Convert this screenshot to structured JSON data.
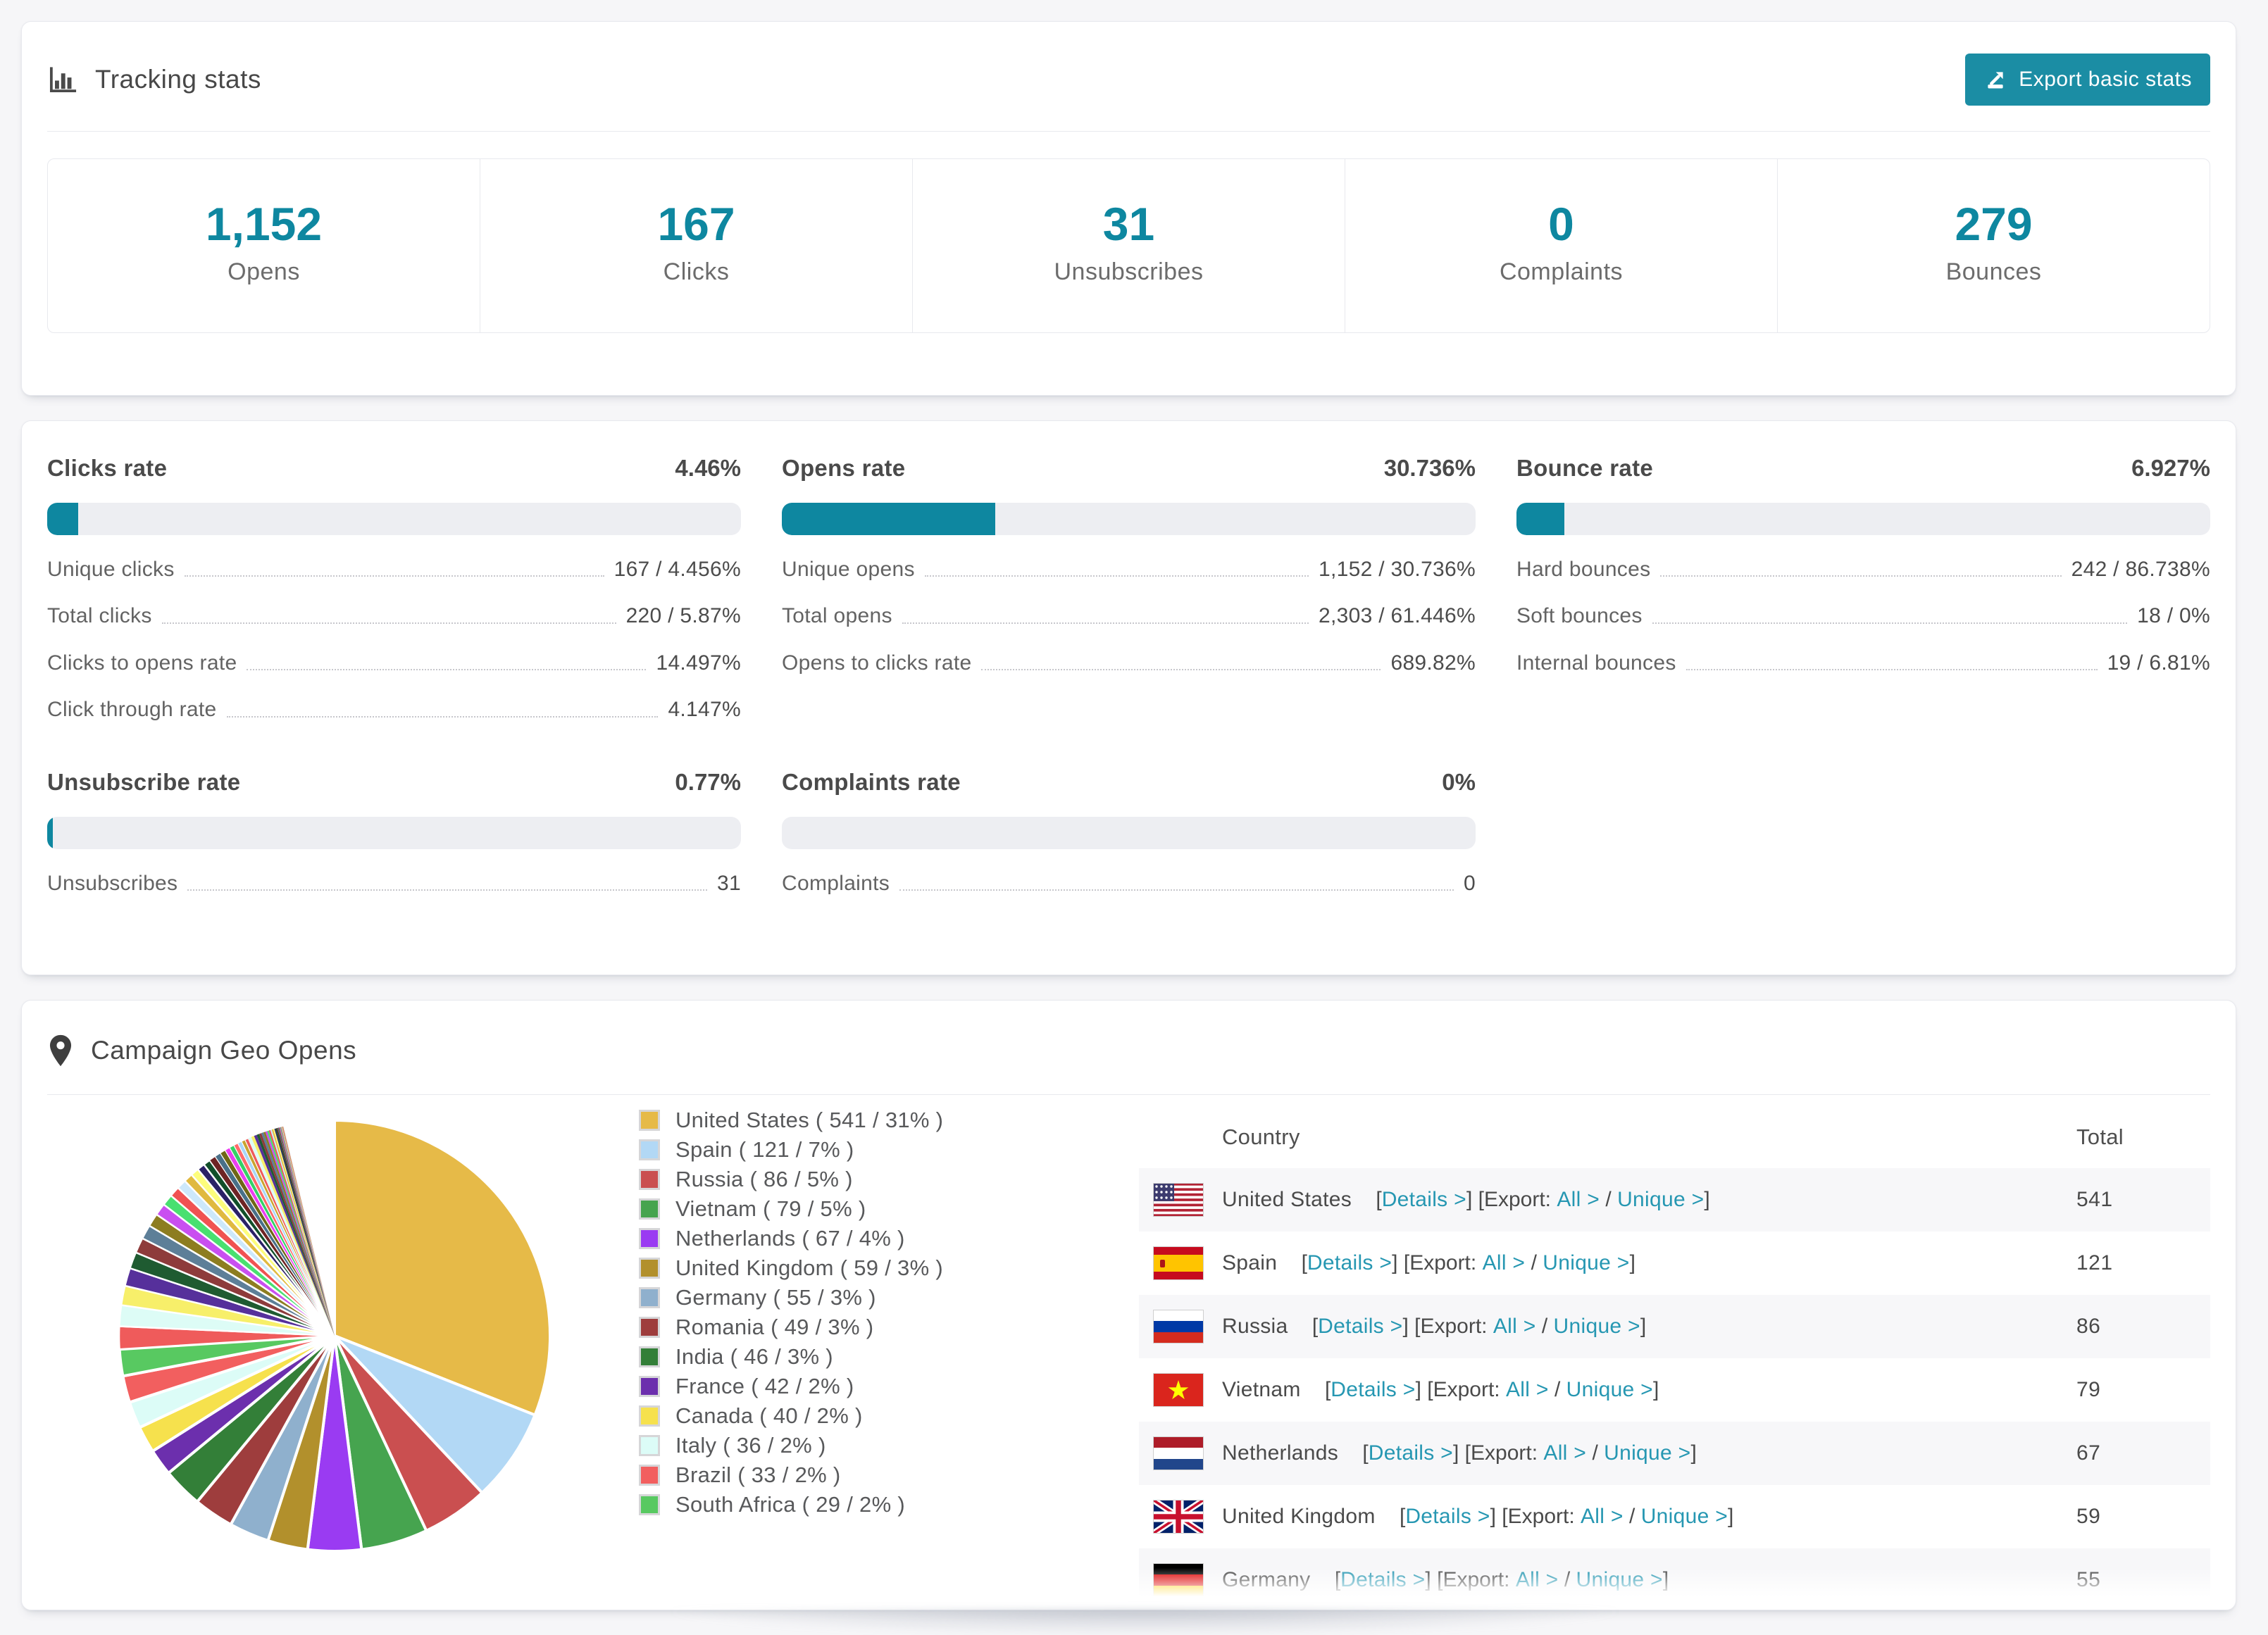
{
  "colors": {
    "accent": "#0e87a0",
    "button": "#1b8da4",
    "link": "#2697b2",
    "track": "#edeef2",
    "zebra": "#f7f7f9",
    "page_bg": "#f6f6f8"
  },
  "header": {
    "title": "Tracking stats",
    "export_label": "Export basic stats"
  },
  "summary_stats": [
    {
      "value": "1,152",
      "label": "Opens"
    },
    {
      "value": "167",
      "label": "Clicks"
    },
    {
      "value": "31",
      "label": "Unsubscribes"
    },
    {
      "value": "0",
      "label": "Complaints"
    },
    {
      "value": "279",
      "label": "Bounces"
    }
  ],
  "rates": [
    {
      "title": "Clicks rate",
      "value": "4.46%",
      "pct": 4.46,
      "rows": [
        {
          "label": "Unique clicks",
          "value": "167 / 4.456%"
        },
        {
          "label": "Total clicks",
          "value": "220 / 5.87%"
        },
        {
          "label": "Clicks to opens rate",
          "value": "14.497%"
        },
        {
          "label": "Click through rate",
          "value": "4.147%"
        }
      ]
    },
    {
      "title": "Opens rate",
      "value": "30.736%",
      "pct": 30.736,
      "rows": [
        {
          "label": "Unique opens",
          "value": "1,152 / 30.736%"
        },
        {
          "label": "Total opens",
          "value": "2,303 / 61.446%"
        },
        {
          "label": "Opens to clicks rate",
          "value": "689.82%"
        }
      ]
    },
    {
      "title": "Bounce rate",
      "value": "6.927%",
      "pct": 6.927,
      "rows": [
        {
          "label": "Hard bounces",
          "value": "242 / 86.738%"
        },
        {
          "label": "Soft bounces",
          "value": "18 / 0%"
        },
        {
          "label": "Internal bounces",
          "value": "19 / 6.81%"
        }
      ]
    },
    {
      "title": "Unsubscribe rate",
      "value": "0.77%",
      "pct": 0.77,
      "rows": [
        {
          "label": "Unsubscribes",
          "value": "31"
        }
      ]
    },
    {
      "title": "Complaints rate",
      "value": "0%",
      "pct": 0,
      "rows": [
        {
          "label": "Complaints",
          "value": "0"
        }
      ]
    }
  ],
  "geo": {
    "title": "Campaign Geo Opens",
    "table": {
      "columns": [
        "Country",
        "Total"
      ],
      "links": {
        "details": "Details >",
        "export_prefix": "Export:",
        "all": "All >",
        "unique": "Unique >"
      },
      "rows": [
        {
          "flag": "us",
          "country": "United States",
          "total": "541"
        },
        {
          "flag": "es",
          "country": "Spain",
          "total": "121"
        },
        {
          "flag": "ru",
          "country": "Russia",
          "total": "86"
        },
        {
          "flag": "vn",
          "country": "Vietnam",
          "total": "79"
        },
        {
          "flag": "nl",
          "country": "Netherlands",
          "total": "67"
        },
        {
          "flag": "gb",
          "country": "United Kingdom",
          "total": "59"
        },
        {
          "flag": "de",
          "country": "Germany",
          "total": "55"
        }
      ]
    }
  },
  "chart_data": {
    "type": "pie",
    "title": "Campaign Geo Opens",
    "unit": "opens",
    "legend_format": "{name} ( {value} / {pct}% )",
    "start_angle_deg": 0,
    "direction": "clockwise",
    "countries": [
      {
        "name": "United States",
        "value": 541,
        "pct": 31,
        "color": "#e6ba48"
      },
      {
        "name": "Spain",
        "value": 121,
        "pct": 7,
        "color": "#b2d8f5"
      },
      {
        "name": "Russia",
        "value": 86,
        "pct": 5,
        "color": "#ca4f50"
      },
      {
        "name": "Vietnam",
        "value": 79,
        "pct": 5,
        "color": "#46a44f"
      },
      {
        "name": "Netherlands",
        "value": 67,
        "pct": 4,
        "color": "#9a3bf2"
      },
      {
        "name": "United Kingdom",
        "value": 59,
        "pct": 3,
        "color": "#b2902c"
      },
      {
        "name": "Germany",
        "value": 55,
        "pct": 3,
        "color": "#8fb0cd"
      },
      {
        "name": "Romania",
        "value": 49,
        "pct": 3,
        "color": "#9e3d3d"
      },
      {
        "name": "India",
        "value": 46,
        "pct": 3,
        "color": "#337f38"
      },
      {
        "name": "France",
        "value": 42,
        "pct": 2,
        "color": "#6c2fad"
      },
      {
        "name": "Canada",
        "value": 40,
        "pct": 2,
        "color": "#f6e14d"
      },
      {
        "name": "Italy",
        "value": 36,
        "pct": 2,
        "color": "#dcfcf7"
      },
      {
        "name": "Brazil",
        "value": 33,
        "pct": 2,
        "color": "#f25f5f"
      },
      {
        "name": "South Africa",
        "value": 29,
        "pct": 2,
        "color": "#58c961"
      }
    ],
    "others": {
      "count": 50,
      "first_pct": 1.7,
      "decay": 0.925,
      "palette": [
        "#ef5b5b",
        "#ddfcf6",
        "#f7ef6a",
        "#56309b",
        "#1f5b31",
        "#8e3b3b",
        "#5d7f98",
        "#8d7d20",
        "#c94ff0",
        "#49e070",
        "#f05252",
        "#cde8fb",
        "#e0b93f",
        "#fdfd7c",
        "#2b2166",
        "#114f2a",
        "#6e2424",
        "#497089",
        "#6f6616",
        "#ea3ff0",
        "#34d167",
        "#ff6a6a",
        "#a9d7f7",
        "#caa32e"
      ]
    }
  }
}
